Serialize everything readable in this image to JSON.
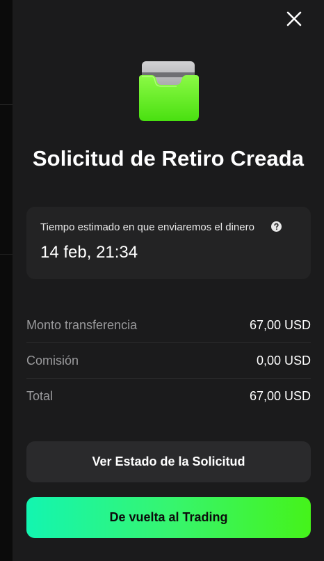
{
  "dialog": {
    "title": "Solicitud de Retiro Creada",
    "estimate": {
      "label": "Tiempo estimado en que enviaremos el dinero",
      "value": "14 feb, 21:34"
    },
    "details": [
      {
        "label": "Monto transferencia",
        "value": "67,00 USD"
      },
      {
        "label": "Comisión",
        "value": "0,00 USD"
      },
      {
        "label": "Total",
        "value": "67,00 USD"
      }
    ],
    "buttons": {
      "status": "Ver Estado de la Solicitud",
      "trading": "De vuelta al Trading"
    }
  },
  "colors": {
    "panel_bg": "#1b1b1c",
    "card_bg": "#232324",
    "accent_green": "#45f31a",
    "accent_teal": "#13f5b0"
  },
  "icons": [
    "close-icon",
    "wallet-card-icon",
    "help-icon"
  ]
}
